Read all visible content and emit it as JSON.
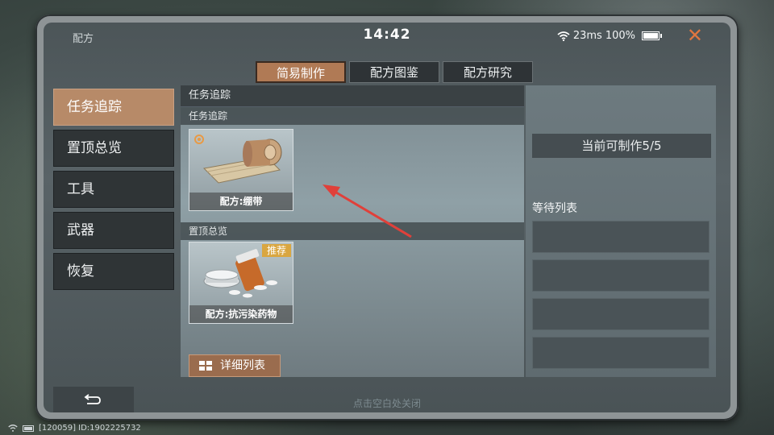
{
  "status": {
    "app_name": "配方",
    "time": "14:42",
    "latency": "23ms",
    "battery": "100%",
    "close_icon": "close-icon"
  },
  "tabs": [
    {
      "label": "简易制作",
      "active": true
    },
    {
      "label": "配方图鉴",
      "active": false
    },
    {
      "label": "配方研究",
      "active": false
    }
  ],
  "sidebar": {
    "items": [
      {
        "label": "任务追踪",
        "active": true
      },
      {
        "label": "置顶总览",
        "active": false
      },
      {
        "label": "工具",
        "active": false
      },
      {
        "label": "武器",
        "active": false
      },
      {
        "label": "恢复",
        "active": false
      }
    ]
  },
  "content": {
    "header": "任务追踪",
    "sections": [
      {
        "label": "任务追踪",
        "card": {
          "caption": "配方:绷带",
          "icon": "bandage-icon"
        }
      },
      {
        "label": "置顶总览",
        "card": {
          "caption": "配方:抗污染药物",
          "badge": "推荐",
          "icon": "medicine-icon"
        }
      }
    ],
    "detail_button": "详细列表"
  },
  "right_panel": {
    "craft_count": "当前可制作5/5",
    "queue_title": "等待列表"
  },
  "bottom": {
    "hint": "点击空白处关闭"
  },
  "footer": {
    "id_text": "[120059] ID:1902225732"
  },
  "colors": {
    "accent": "#b07a55",
    "close": "#e0763f",
    "badge": "#d9a640",
    "arrow": "#e0403a"
  }
}
